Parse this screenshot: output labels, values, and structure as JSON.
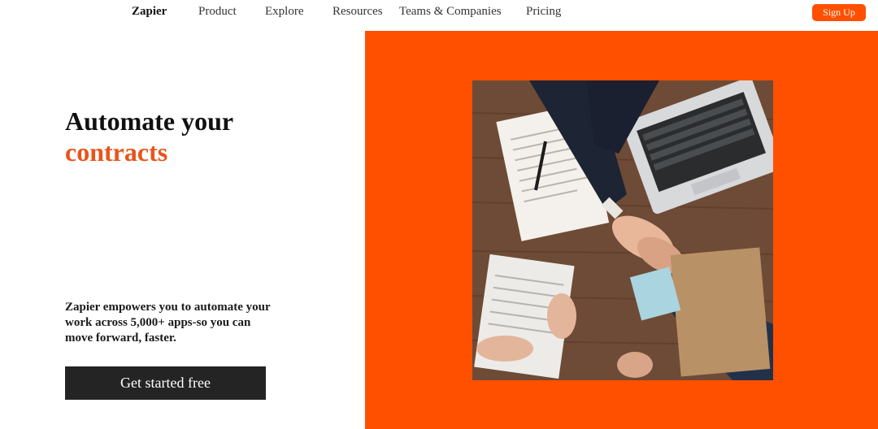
{
  "nav": {
    "brand": "Zapier",
    "links": [
      "Product",
      "Explore",
      "Resources",
      "Teams & Companies",
      "Pricing"
    ],
    "signup_label": "Sign Up"
  },
  "hero": {
    "title_line1": "Automate your",
    "title_line2": "contracts",
    "subtitle": "Zapier empowers you to automate your work across 5,000+ apps-so you can move forward, faster.",
    "cta_label": "Get started free"
  },
  "colors": {
    "accent": "#ff5000",
    "title_accent": "#e8541c",
    "cta_bg": "#242424"
  },
  "image": {
    "icon": "handshake-photo"
  }
}
